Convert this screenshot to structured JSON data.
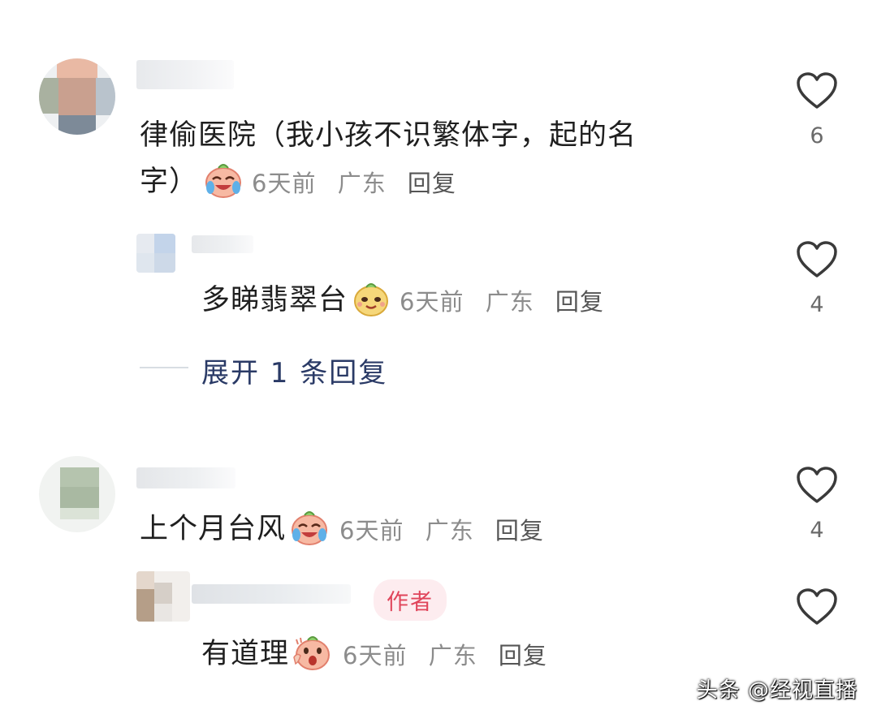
{
  "comments": [
    {
      "text_line1": "律偷医院（我小孩不识繁体字，起的名",
      "text_line2": "字）",
      "emoji": "crying-laughing-emoji",
      "time": "6天前",
      "location": "广东",
      "reply_label": "回复",
      "likes": "6",
      "replies": [
        {
          "text": "多睇翡翠台",
          "emoji": "smug-face-emoji",
          "time": "6天前",
          "location": "广东",
          "reply_label": "回复",
          "likes": "4"
        }
      ],
      "expand_label": "展开 1 条回复"
    },
    {
      "text": "上个月台风",
      "emoji": "crying-laughing-emoji",
      "time": "6天前",
      "location": "广东",
      "reply_label": "回复",
      "likes": "4",
      "replies": [
        {
          "author_badge": "作者",
          "text": "有道理",
          "emoji": "shocked-face-emoji",
          "time": "6天前",
          "location": "广东",
          "reply_label": "回复",
          "likes": ""
        }
      ]
    }
  ],
  "watermark": "头条 @经视直播",
  "colors": {
    "text": "#1f1f1f",
    "meta": "#8c8c8c",
    "expand": "#2a3a66",
    "author_badge_bg": "#fdecef",
    "author_badge_text": "#e0445a"
  }
}
